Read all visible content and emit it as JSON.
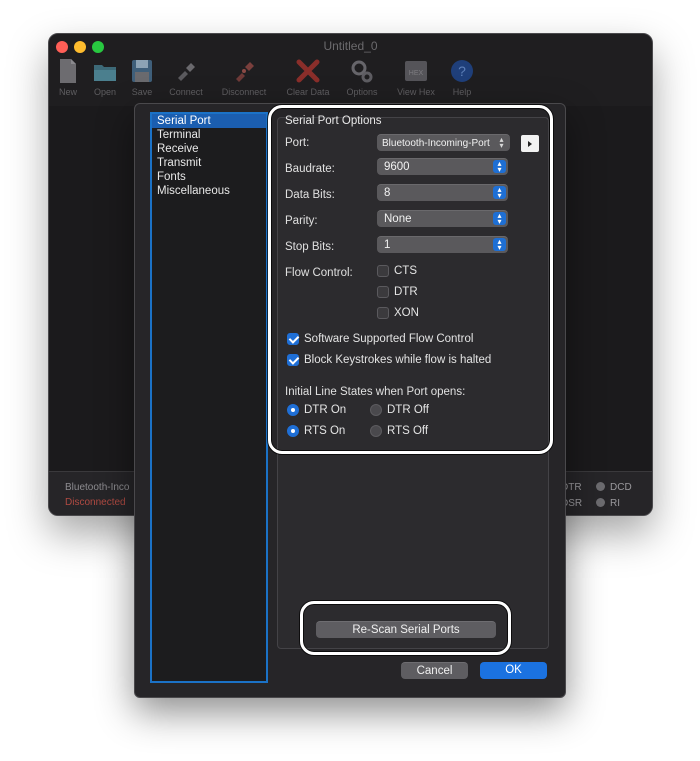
{
  "window": {
    "title": "Untitled_0"
  },
  "toolbar": {
    "items": [
      {
        "label": "New",
        "icon": "document-icon"
      },
      {
        "label": "Open",
        "icon": "folder-icon"
      },
      {
        "label": "Save",
        "icon": "floppy-icon"
      },
      {
        "label": "Connect",
        "icon": "plug-icon"
      },
      {
        "label": "Disconnect",
        "icon": "unplug-icon"
      },
      {
        "label": "Clear Data",
        "icon": "red-x-icon"
      },
      {
        "label": "Options",
        "icon": "gears-icon"
      },
      {
        "label": "View Hex",
        "icon": "hex-icon"
      },
      {
        "label": "Help",
        "icon": "question-icon"
      }
    ],
    "hex_glyph": "HEX",
    "help_glyph": "?"
  },
  "statusbar": {
    "port": "Bluetooth-Inco",
    "connection": "Disconnected",
    "indicators": [
      "DTR",
      "DCD",
      "DSR",
      "RI"
    ]
  },
  "sidebar": {
    "items": [
      "Serial Port",
      "Terminal",
      "Receive",
      "Transmit",
      "Fonts",
      "Miscellaneous"
    ],
    "selected": "Serial Port"
  },
  "serial_options": {
    "group_title": "Serial Port Options",
    "port_label": "Port:",
    "port_value": "Bluetooth-Incoming-Port",
    "baudrate_label": "Baudrate:",
    "baudrate_value": "9600",
    "databits_label": "Data Bits:",
    "databits_value": "8",
    "parity_label": "Parity:",
    "parity_value": "None",
    "stopbits_label": "Stop Bits:",
    "stopbits_value": "1",
    "flow_label": "Flow Control:",
    "flow_options": [
      {
        "label": "CTS",
        "checked": false
      },
      {
        "label": "DTR",
        "checked": false
      },
      {
        "label": "XON",
        "checked": false
      }
    ],
    "software_flow_label": "Software Supported Flow Control",
    "software_flow_checked": true,
    "block_keys_label": "Block Keystrokes while flow is halted",
    "block_keys_checked": true,
    "line_states_label": "Initial Line States when Port opens:",
    "dtr_on": "DTR On",
    "dtr_off": "DTR Off",
    "rts_on": "RTS On",
    "rts_off": "RTS Off"
  },
  "buttons": {
    "rescan": "Re-Scan Serial Ports",
    "cancel": "Cancel",
    "ok": "OK"
  },
  "colors": {
    "accent": "#1f6fd6",
    "highlight": "#ffffff",
    "disconnected": "#b04a42"
  }
}
